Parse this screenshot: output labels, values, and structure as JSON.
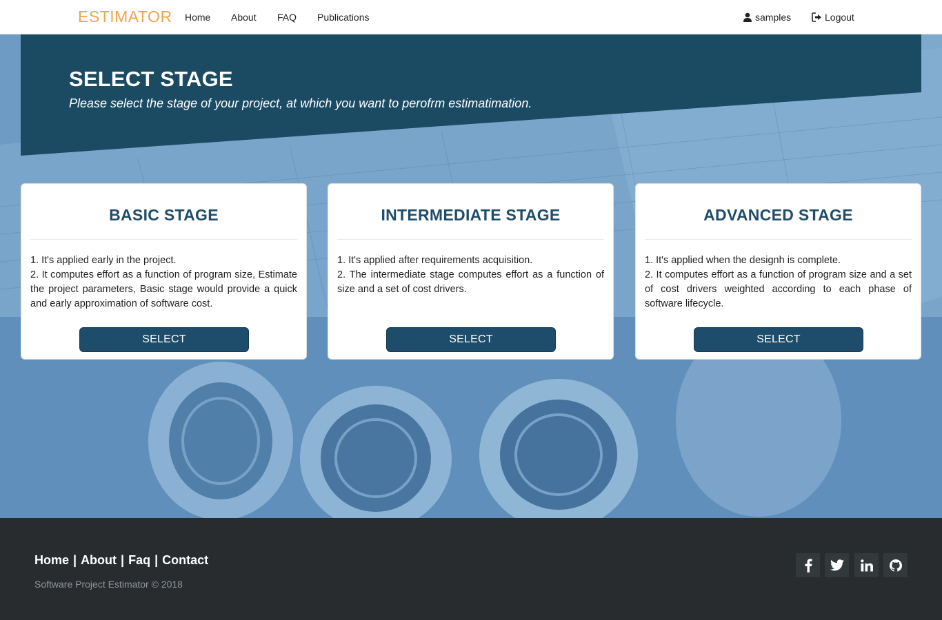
{
  "brand": "ESTIMATOR",
  "nav": {
    "home": "Home",
    "about": "About",
    "faq": "FAQ",
    "publications": "Publications",
    "user": "samples",
    "logout": "Logout"
  },
  "banner": {
    "title": "SELECT STAGE",
    "subtitle": "Please select the stage of your project, at which you want to perofrm estimatimation."
  },
  "cards": [
    {
      "title": "BASIC STAGE",
      "line1": "1. It's applied early in the project.",
      "line2": "2. It computes effort as a function of program size, Estimate the project parameters, Basic stage would provide a quick and early approximation of software cost.",
      "button": "SELECT"
    },
    {
      "title": "INTERMEDIATE STAGE",
      "line1": "1. It's applied after requirements acquisition.",
      "line2": "2. The intermediate stage computes effort as a function of size and a set of cost drivers.",
      "button": "SELECT"
    },
    {
      "title": "ADVANCED STAGE",
      "line1": "1. It's applied when the designh is complete.",
      "line2": "2. It computes effort as a function of program size and a set of cost drivers weighted according to each phase of software lifecycle.",
      "button": "SELECT"
    }
  ],
  "footer": {
    "home": "Home",
    "about": "About",
    "faq": "Faq",
    "contact": "Contact",
    "separator": "|",
    "copyright": "Software Project Estimator © 2018"
  },
  "social": [
    "facebook-icon",
    "twitter-icon",
    "linkedin-icon",
    "github-icon"
  ],
  "colors": {
    "brand": "#f0a44a",
    "primary": "#1e4c6b",
    "banner": "#1b4a63",
    "footer": "#292c2f"
  }
}
